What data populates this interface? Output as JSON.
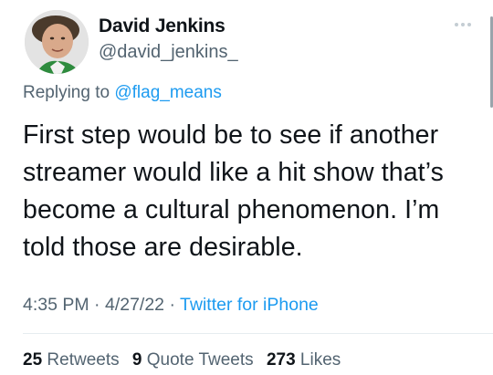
{
  "author": {
    "name": "David Jenkins",
    "handle": "@david_jenkins_"
  },
  "reply": {
    "prefix": "Replying to",
    "handle": "@flag_means"
  },
  "tweet": {
    "text": "First step would be to see if another streamer would like a hit show that’s become a cultural phenomenon. I’m told those are desirable."
  },
  "meta": {
    "time": "4:35 PM",
    "date": "4/27/22",
    "separator": "·",
    "source": "Twitter for iPhone"
  },
  "stats": {
    "retweets_count": "25",
    "retweets_label": "Retweets",
    "quotes_count": "9",
    "quotes_label": "Quote Tweets",
    "likes_count": "273",
    "likes_label": "Likes"
  },
  "colors": {
    "accent": "#1d9bf0",
    "secondary_text": "#536471",
    "primary_text": "#0f1419"
  },
  "icons": {
    "more": "more-horizontal-icon",
    "avatar": "profile-photo"
  }
}
